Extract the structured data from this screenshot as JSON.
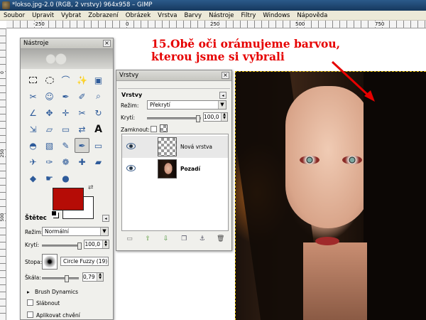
{
  "window": {
    "title": "*lokso.jpg-2.0 (RGB, 2 vrstvy) 964x958 – GIMP"
  },
  "menu": {
    "items": [
      "Soubor",
      "Upravit",
      "Vybrat",
      "Zobrazení",
      "Obrázek",
      "Vrstva",
      "Barvy",
      "Nástroje",
      "Filtry",
      "Windows",
      "Nápověda"
    ]
  },
  "rulers": {
    "top_labels": [
      "-250",
      "0",
      "250",
      "500",
      "750"
    ],
    "left_labels": [
      "0",
      "250",
      "500"
    ]
  },
  "annotation": {
    "line1": "15.Obě oči orámujeme barvou,",
    "line2": "kterou jsme si vybrali",
    "color": "#e60000"
  },
  "toolbox": {
    "title": "Nástroje",
    "close": "×",
    "tools": [
      {
        "name": "rect-select-icon",
        "glyph": ""
      },
      {
        "name": "ellipse-select-icon",
        "glyph": ""
      },
      {
        "name": "free-select-icon",
        "glyph": "⌒"
      },
      {
        "name": "fuzzy-select-icon",
        "glyph": "✨"
      },
      {
        "name": "select-by-color-icon",
        "glyph": "▣"
      },
      {
        "name": "scissors-select-icon",
        "glyph": "✂"
      },
      {
        "name": "foreground-select-icon",
        "glyph": "☺"
      },
      {
        "name": "paths-icon",
        "glyph": "✒"
      },
      {
        "name": "color-picker-icon",
        "glyph": "✐"
      },
      {
        "name": "zoom-icon",
        "glyph": "⌕"
      },
      {
        "name": "measure-icon",
        "glyph": "∠"
      },
      {
        "name": "move-icon",
        "glyph": "✥"
      },
      {
        "name": "align-icon",
        "glyph": "✛"
      },
      {
        "name": "crop-icon",
        "glyph": "✂"
      },
      {
        "name": "rotate-icon",
        "glyph": "↻"
      },
      {
        "name": "scale-icon",
        "glyph": "⇲"
      },
      {
        "name": "shear-icon",
        "glyph": "▱"
      },
      {
        "name": "perspective-icon",
        "glyph": "▭"
      },
      {
        "name": "flip-icon",
        "glyph": "⇄"
      },
      {
        "name": "text-icon",
        "glyph": "A"
      },
      {
        "name": "bucket-fill-icon",
        "glyph": "◓"
      },
      {
        "name": "blend-icon",
        "glyph": "▧"
      },
      {
        "name": "pencil-icon",
        "glyph": "✎"
      },
      {
        "name": "paintbrush-icon",
        "glyph": "✒"
      },
      {
        "name": "eraser-icon",
        "glyph": "▭"
      },
      {
        "name": "airbrush-icon",
        "glyph": "✈"
      },
      {
        "name": "ink-icon",
        "glyph": "✑"
      },
      {
        "name": "clone-icon",
        "glyph": "❁"
      },
      {
        "name": "heal-icon",
        "glyph": "✚"
      },
      {
        "name": "perspective-clone-icon",
        "glyph": "▰"
      },
      {
        "name": "blur-icon",
        "glyph": "◆"
      },
      {
        "name": "smudge-icon",
        "glyph": "☛"
      },
      {
        "name": "dodge-burn-icon",
        "glyph": "●"
      }
    ],
    "colors": {
      "foreground": "#b50c06",
      "background": "#ffffff"
    }
  },
  "brush_options": {
    "title": "Štětec",
    "mode_label": "Režim:",
    "mode_value": "Normální",
    "opacity_label": "Krytí:",
    "opacity_value": "100,0",
    "brush_label": "Stopa:",
    "brush_value": "Circle Fuzzy (19)",
    "scale_label": "Škála:",
    "scale_value": "0,79",
    "dynamics_label": "Brush Dynamics",
    "fade_label": "Slábnout",
    "jitter_label": "Aplikovat chvění"
  },
  "layers": {
    "title": "Vrstvy",
    "inner_title": "Vrstvy",
    "mode_label": "Režim:",
    "mode_value": "Překrytí",
    "opacity_label": "Krytí:",
    "opacity_value": "100,0",
    "lock_label": "Zamknout:",
    "items": [
      {
        "name": "Nová vrstva",
        "bold": false
      },
      {
        "name": "Pozadí",
        "bold": true
      }
    ]
  }
}
